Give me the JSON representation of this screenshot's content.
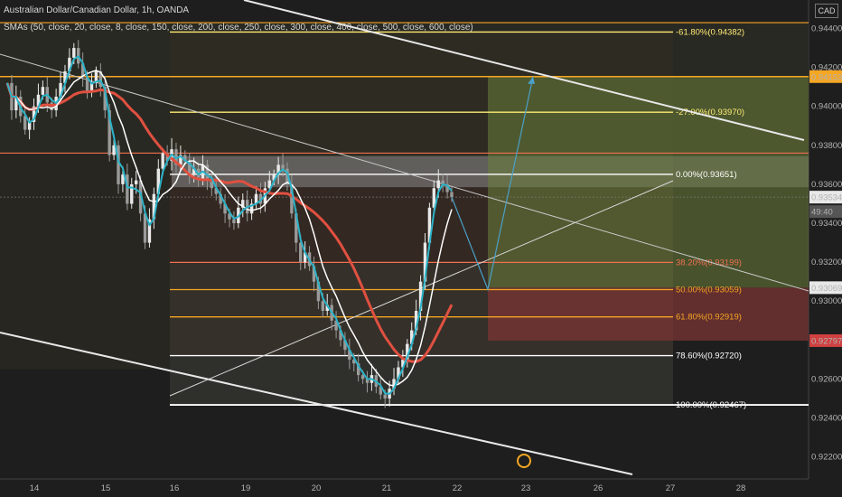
{
  "header": {
    "title": "Australian Dollar/Canadian Dollar, 1h, OANDA",
    "indicator": "SMAs (50, close, 20, close, 8, close, 150, close, 200, close, 250, close, 300, close, 400, close, 500, close, 600, close)"
  },
  "currency_badge": "CAD",
  "colors": {
    "background": "#1e1e1e",
    "candle": "#c8c8c8",
    "sma_fast": "#2bb3c8",
    "sma_slow": "#ffffff",
    "sma_red": "#e05040",
    "fib_orange": "#f5a623",
    "fib_yellow": "#ffeb74",
    "fib_red": "#f07050",
    "projection": "#4aa0c8",
    "profit_zone": "#6b7f3a",
    "loss_zone": "#7a3434"
  },
  "chart_data": {
    "type": "line",
    "ylim": [
      0.9211,
      0.945
    ],
    "y_ticks": [
      "0.94400",
      "0.94200",
      "0.94000",
      "0.93800",
      "0.93600",
      "0.93400",
      "0.93200",
      "0.93000",
      "0.92800",
      "0.92600",
      "0.92400",
      "0.92200"
    ],
    "x_ticks": [
      "14",
      "15",
      "16",
      "19",
      "20",
      "21",
      "22",
      "23",
      "26",
      "27",
      "28"
    ],
    "price_labels": [
      {
        "value": "0.94153",
        "kind": "orange"
      },
      {
        "value": "0.93534",
        "kind": "white"
      },
      {
        "value": "49:40",
        "kind": "timer"
      },
      {
        "value": "0.93069",
        "kind": "white"
      },
      {
        "value": "0.92797",
        "kind": "red"
      }
    ],
    "fib_levels": [
      {
        "label": "-61.80%(0.94382)",
        "value": 0.94382,
        "color": "yellow"
      },
      {
        "label": "-27.00%(0.93970)",
        "value": 0.9397,
        "color": "yellow"
      },
      {
        "label": "0.00%(0.93651)",
        "value": 0.93651,
        "color": "white"
      },
      {
        "label": "38.20%(0.93199)",
        "value": 0.93199,
        "color": "red"
      },
      {
        "label": "50.00%(0.93059)",
        "value": 0.93059,
        "color": "orange"
      },
      {
        "label": "61.80%(0.92919)",
        "value": 0.92919,
        "color": "orange"
      },
      {
        "label": "78.60%(0.92720)",
        "value": 0.9272,
        "color": "white"
      },
      {
        "label": "100.00%(0.92467)",
        "value": 0.92467,
        "color": "white"
      }
    ],
    "horizontal_levels": [
      0.9443,
      0.94153,
      0.9376
    ],
    "closes": [
      0.9412,
      0.9398,
      0.9405,
      0.9395,
      0.9388,
      0.9392,
      0.94,
      0.9406,
      0.941,
      0.9402,
      0.9398,
      0.9405,
      0.9412,
      0.9418,
      0.9425,
      0.943,
      0.9422,
      0.9415,
      0.9408,
      0.9412,
      0.9418,
      0.941,
      0.9398,
      0.9375,
      0.938,
      0.936,
      0.9365,
      0.935,
      0.936,
      0.9362,
      0.9345,
      0.933,
      0.9342,
      0.9355,
      0.9368,
      0.9376,
      0.9372,
      0.9378,
      0.937,
      0.9375,
      0.9372,
      0.9365,
      0.9368,
      0.9362,
      0.937,
      0.9362,
      0.9358,
      0.9355,
      0.935,
      0.9345,
      0.9342,
      0.934,
      0.9348,
      0.9352,
      0.9345,
      0.935,
      0.9355,
      0.935,
      0.9358,
      0.9362,
      0.9365,
      0.937,
      0.9368,
      0.936,
      0.9345,
      0.933,
      0.932,
      0.9325,
      0.9318,
      0.931,
      0.93,
      0.9295,
      0.9298,
      0.929,
      0.9285,
      0.928,
      0.9275,
      0.927,
      0.9268,
      0.9262,
      0.926,
      0.9258,
      0.9262,
      0.9256,
      0.9252,
      0.925,
      0.9255,
      0.926,
      0.9266,
      0.927,
      0.9278,
      0.9285,
      0.9295,
      0.931,
      0.933,
      0.9348,
      0.9358,
      0.9362,
      0.936,
      0.9356,
      0.93534
    ],
    "projection": [
      0.93534,
      0.9306,
      0.94153
    ]
  }
}
